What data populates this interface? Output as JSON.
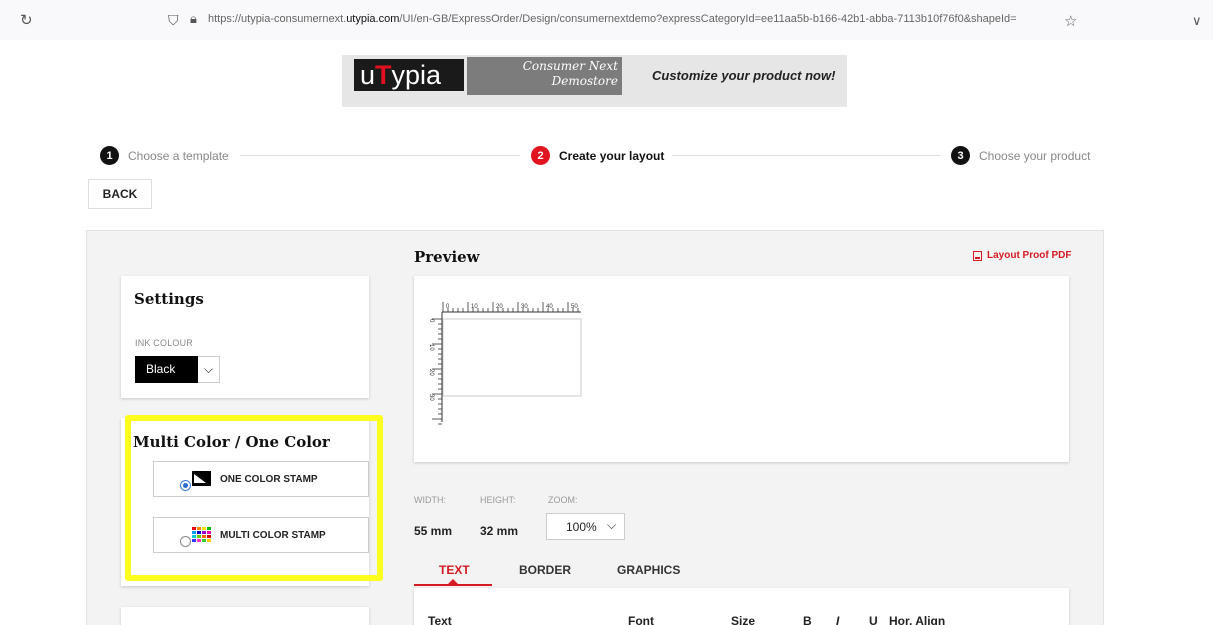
{
  "browser": {
    "url_prefix": "https://utypia-consumernext.",
    "url_domain": "utypia.com",
    "url_suffix": "/UI/en-GB/ExpressOrder/Design/consumernextdemo?expressCategoryId=ee11aa5b-b166-42b1-abba-7113b10f76f0&shapeId="
  },
  "banner": {
    "logo_u": "u",
    "logo_t": "T",
    "logo_rest": "ypia",
    "demo_line1": "Consumer Next",
    "demo_line2": "Demostore",
    "tagline": "Customize your product now!"
  },
  "stepper": {
    "steps": [
      {
        "num": "1",
        "label": "Choose a template"
      },
      {
        "num": "2",
        "label": "Create your layout"
      },
      {
        "num": "3",
        "label": "Choose your product"
      }
    ],
    "active": 2
  },
  "back_label": "BACK",
  "settings": {
    "title": "Settings",
    "ink_label": "INK COLOUR",
    "ink_value": "Black"
  },
  "color_mode": {
    "title": "Multi Color / One Color",
    "options": [
      {
        "label": "ONE COLOR STAMP",
        "selected": true
      },
      {
        "label": "MULTI COLOR STAMP",
        "selected": false
      }
    ]
  },
  "preview": {
    "title": "Preview",
    "proof_link": "Layout Proof PDF",
    "ruler_h": [
      "0",
      "10",
      "20",
      "30",
      "40",
      "50"
    ],
    "ruler_v": [
      "0",
      "10",
      "20",
      "30"
    ]
  },
  "dimensions": {
    "width_label": "WIDTH:",
    "height_label": "HEIGHT:",
    "zoom_label": "ZOOM:",
    "width_value": "55 mm",
    "height_value": "32 mm",
    "zoom_value": "100%"
  },
  "tabs": [
    "TEXT",
    "BORDER",
    "GRAPHICS"
  ],
  "text_columns": [
    "Text",
    "Font",
    "Size",
    "B",
    "I",
    "U",
    "Hor. Align"
  ],
  "colors": {
    "accent": "#d51a23",
    "highlight": "#ffff1f",
    "radio": "#2a68d0"
  }
}
